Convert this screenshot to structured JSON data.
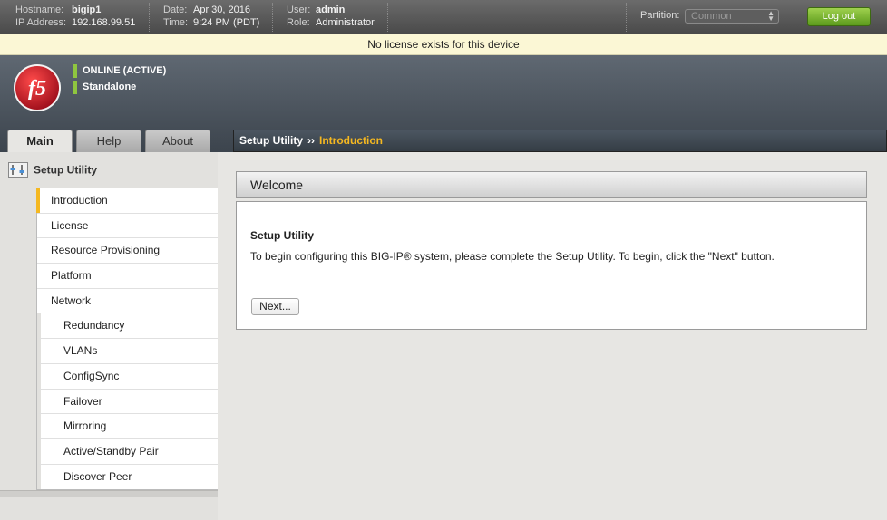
{
  "topbar": {
    "hostname_label": "Hostname:",
    "hostname": "bigip1",
    "ip_label": "IP Address:",
    "ip": "192.168.99.51",
    "date_label": "Date:",
    "date": "Apr 30, 2016",
    "time_label": "Time:",
    "time": "9:24 PM (PDT)",
    "user_label": "User:",
    "user": "admin",
    "role_label": "Role:",
    "role": "Administrator",
    "partition_label": "Partition:",
    "partition_value": "Common",
    "logout_label": "Log out"
  },
  "banner": {
    "text": "No license exists for this device"
  },
  "header": {
    "status_primary": "ONLINE (ACTIVE)",
    "status_secondary": "Standalone",
    "logo_text": "f5"
  },
  "tabs": [
    {
      "label": "Main"
    },
    {
      "label": "Help"
    },
    {
      "label": "About"
    }
  ],
  "breadcrumb": {
    "parent": "Setup Utility",
    "separator": "››",
    "current": "Introduction"
  },
  "sidebar": {
    "heading": "Setup Utility",
    "items": [
      {
        "label": "Introduction"
      },
      {
        "label": "License"
      },
      {
        "label": "Resource Provisioning"
      },
      {
        "label": "Platform"
      },
      {
        "label": "Network"
      },
      {
        "label": "Redundancy"
      },
      {
        "label": "VLANs"
      },
      {
        "label": "ConfigSync"
      },
      {
        "label": "Failover"
      },
      {
        "label": "Mirroring"
      },
      {
        "label": "Active/Standby Pair"
      },
      {
        "label": "Discover Peer"
      }
    ]
  },
  "main": {
    "panel_title": "Welcome",
    "section_title": "Setup Utility",
    "description": "To begin configuring this BIG-IP® system, please complete the Setup Utility. To begin, click the \"Next\" button.",
    "next_label": "Next..."
  },
  "colors": {
    "accent": "#f5b820",
    "status_green": "#8fc63f",
    "logout_green": "#6aa824",
    "banner_bg": "#fbf7d5",
    "logo_red": "#d2202f"
  }
}
